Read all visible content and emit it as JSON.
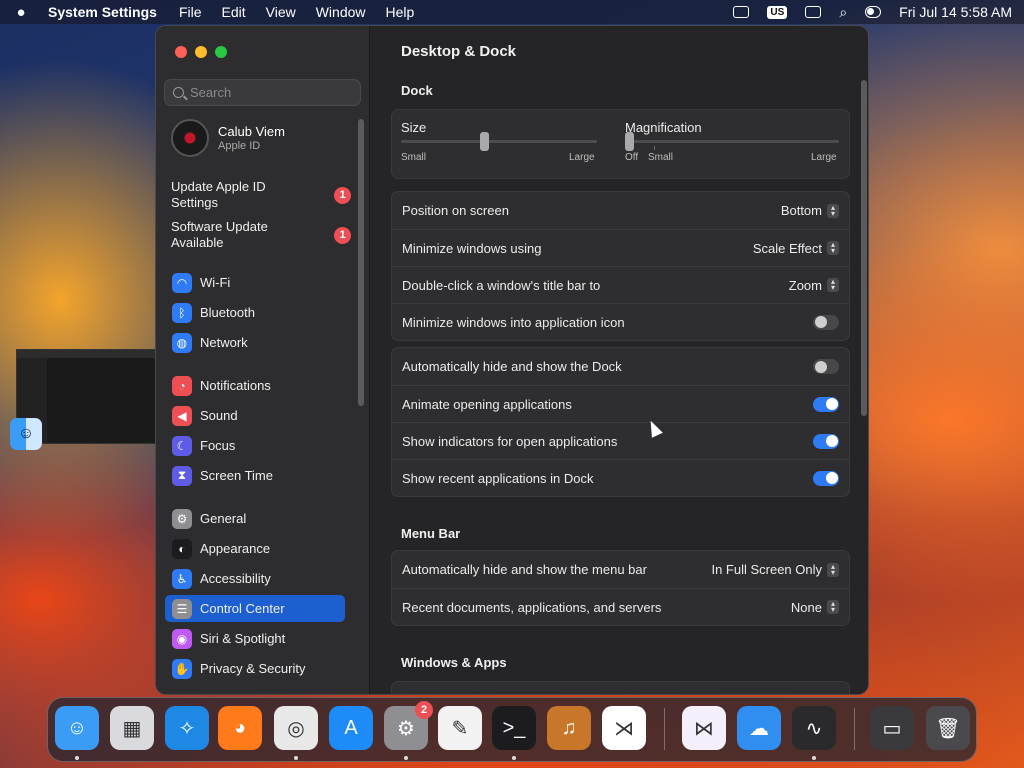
{
  "menubar": {
    "app_name": "System Settings",
    "menus": [
      "File",
      "Edit",
      "View",
      "Window",
      "Help"
    ],
    "input_source": "US",
    "clock": "Fri Jul 14  5:58 AM"
  },
  "sidebar": {
    "search_placeholder": "Search",
    "profile": {
      "name": "Calub Viem",
      "subtitle": "Apple ID"
    },
    "notices": [
      {
        "label": "Update Apple ID Settings",
        "badge": "1"
      },
      {
        "label": "Software Update Available",
        "badge": "1"
      }
    ],
    "groups": [
      [
        {
          "label": "Wi-Fi",
          "icon": "wifi-icon",
          "color": "#2f7bf5",
          "glyph": "◠"
        },
        {
          "label": "Bluetooth",
          "icon": "bluetooth-icon",
          "color": "#2f7bf5",
          "glyph": "ᛒ"
        },
        {
          "label": "Network",
          "icon": "globe-icon",
          "color": "#2f7bf5",
          "glyph": "◍"
        }
      ],
      [
        {
          "label": "Notifications",
          "icon": "bell-icon",
          "color": "#ee4f54",
          "glyph": "◔"
        },
        {
          "label": "Sound",
          "icon": "speaker-icon",
          "color": "#ee4f54",
          "glyph": "◀"
        },
        {
          "label": "Focus",
          "icon": "moon-icon",
          "color": "#5e5ce6",
          "glyph": "☾"
        },
        {
          "label": "Screen Time",
          "icon": "hourglass-icon",
          "color": "#5e5ce6",
          "glyph": "⧗"
        }
      ],
      [
        {
          "label": "General",
          "icon": "gear-icon",
          "color": "#8e8e93",
          "glyph": "⚙"
        },
        {
          "label": "Appearance",
          "icon": "appearance-icon",
          "color": "#1c1c1e",
          "glyph": "◐"
        },
        {
          "label": "Accessibility",
          "icon": "accessibility-icon",
          "color": "#2f7bf5",
          "glyph": "♿"
        },
        {
          "label": "Control Center",
          "icon": "control-center-icon",
          "color": "#8e8e93",
          "glyph": "☰",
          "active": true
        },
        {
          "label": "Siri & Spotlight",
          "icon": "siri-icon",
          "color": "#bf5af2",
          "glyph": "◉"
        },
        {
          "label": "Privacy & Security",
          "icon": "hand-icon",
          "color": "#2f7bf5",
          "glyph": "✋"
        }
      ]
    ]
  },
  "content": {
    "title": "Desktop & Dock",
    "dock_section": "Dock",
    "size": {
      "label": "Size",
      "min_label": "Small",
      "max_label": "Large",
      "value": 0.42
    },
    "magnification": {
      "label": "Magnification",
      "off_label": "Off",
      "min_label": "Small",
      "max_label": "Large",
      "value": 0.0
    },
    "group1": [
      {
        "label": "Position on screen",
        "value": "Bottom"
      },
      {
        "label": "Minimize windows using",
        "value": "Scale Effect"
      },
      {
        "label": "Double-click a window's title bar to",
        "value": "Zoom"
      },
      {
        "label": "Minimize windows into application icon",
        "toggle": false
      }
    ],
    "group2": [
      {
        "label": "Automatically hide and show the Dock",
        "toggle": false
      },
      {
        "label": "Animate opening applications",
        "toggle": true
      },
      {
        "label": "Show indicators for open applications",
        "toggle": true
      },
      {
        "label": "Show recent applications in Dock",
        "toggle": true
      }
    ],
    "menubar_section": "Menu Bar",
    "group3": [
      {
        "label": "Automatically hide and show the menu bar",
        "value": "In Full Screen Only"
      },
      {
        "label": "Recent documents, applications, and servers",
        "value": "None"
      }
    ],
    "windows_section": "Windows & Apps"
  },
  "dock": {
    "apps": [
      {
        "name": "Finder",
        "icon": "finder-icon",
        "bg": "#3a9cf5",
        "glyph": "☺",
        "running": true
      },
      {
        "name": "Launchpad",
        "icon": "launchpad-icon",
        "bg": "#d9d9de",
        "glyph": "▦",
        "running": false
      },
      {
        "name": "Safari",
        "icon": "safari-icon",
        "bg": "#1e88e5",
        "glyph": "✧",
        "running": false
      },
      {
        "name": "Firefox",
        "icon": "firefox-icon",
        "bg": "#ff7a1a",
        "glyph": "◕",
        "running": false
      },
      {
        "name": "Chrome",
        "icon": "chrome-icon",
        "bg": "#e8e8e8",
        "glyph": "◎",
        "running": true
      },
      {
        "name": "App Store",
        "icon": "app-store-icon",
        "bg": "#1d8cf8",
        "glyph": "A",
        "running": false
      },
      {
        "name": "System Settings",
        "icon": "system-settings-icon",
        "bg": "#8e8e93",
        "glyph": "⚙",
        "running": true,
        "badge": "2"
      },
      {
        "name": "TextEdit",
        "icon": "textedit-icon",
        "bg": "#f2f2f2",
        "glyph": "✎",
        "running": false
      },
      {
        "name": "Terminal",
        "icon": "terminal-icon",
        "bg": "#1c1c1e",
        "glyph": ">_",
        "running": true
      },
      {
        "name": "GarageBand",
        "icon": "garageband-icon",
        "bg": "#c7762a",
        "glyph": "♫",
        "running": false
      },
      {
        "name": "Visual Studio Code",
        "icon": "vscode-icon",
        "bg": "#ffffff",
        "glyph": "⋊",
        "running": false
      },
      {
        "name": "Visual Studio",
        "icon": "visual-studio-icon",
        "bg": "#f4f0fb",
        "glyph": "⋈",
        "running": false
      },
      {
        "name": "Weather",
        "icon": "weather-icon",
        "bg": "#2f8ef0",
        "glyph": "☁",
        "running": false
      },
      {
        "name": "Activity Monitor",
        "icon": "activity-monitor-icon",
        "bg": "#2a2a2c",
        "glyph": "∿",
        "running": true
      },
      {
        "name": "Chrome Window",
        "icon": "window-thumbnail-icon",
        "bg": "#3a3a3c",
        "glyph": "▭",
        "running": false
      },
      {
        "name": "Trash",
        "icon": "trash-icon",
        "bg": "#4a4a4e",
        "glyph": "🗑",
        "running": false
      }
    ]
  }
}
